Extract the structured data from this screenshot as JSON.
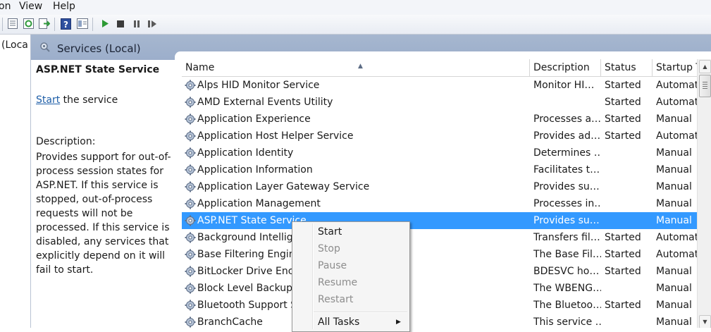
{
  "menubar": {
    "items": [
      "on",
      "View",
      "Help"
    ]
  },
  "tree": {
    "item_label": "(Loca"
  },
  "header": {
    "title": "Services (Local)"
  },
  "description_pane": {
    "title": "ASP.NET State Service",
    "start_link": "Start",
    "start_suffix": " the service",
    "description_label": "Description:",
    "description_text": "Provides support for out-of-process session states for ASP.NET. If this service is stopped, out-of-process requests will not be processed. If this service is disabled, any services that explicitly depend on it will fail to start."
  },
  "columns": [
    "Name",
    "Description",
    "Status",
    "Startup T"
  ],
  "services": [
    {
      "name": "Alps HID Monitor Service",
      "description": "Monitor HI…",
      "status": "Started",
      "startup": "Automat"
    },
    {
      "name": "AMD External Events Utility",
      "description": "",
      "status": "Started",
      "startup": "Automat"
    },
    {
      "name": "Application Experience",
      "description": "Processes a…",
      "status": "Started",
      "startup": "Manual"
    },
    {
      "name": "Application Host Helper Service",
      "description": "Provides ad…",
      "status": "Started",
      "startup": "Automat"
    },
    {
      "name": "Application Identity",
      "description": "Determines …",
      "status": "",
      "startup": "Manual"
    },
    {
      "name": "Application Information",
      "description": "Facilitates t…",
      "status": "",
      "startup": "Manual"
    },
    {
      "name": "Application Layer Gateway Service",
      "description": "Provides su…",
      "status": "",
      "startup": "Manual"
    },
    {
      "name": "Application Management",
      "description": "Processes in…",
      "status": "",
      "startup": "Manual"
    },
    {
      "name": "ASP.NET State Service",
      "description": "Provides su…",
      "status": "",
      "startup": "Manual"
    },
    {
      "name": "Background Intellige",
      "description": "Transfers fil…",
      "status": "Started",
      "startup": "Automat"
    },
    {
      "name": "Base Filtering Engine",
      "description": "The Base Fil…",
      "status": "Started",
      "startup": "Automat"
    },
    {
      "name": "BitLocker Drive Encry",
      "description": "BDESVC ho…",
      "status": "Started",
      "startup": "Manual"
    },
    {
      "name": "Block Level Backup E",
      "description": "The WBENG…",
      "status": "",
      "startup": "Manual"
    },
    {
      "name": "Bluetooth Support S",
      "description": "The Bluetoo…",
      "status": "Started",
      "startup": "Manual"
    },
    {
      "name": "BranchCache",
      "description": "This service …",
      "status": "",
      "startup": "Manual"
    }
  ],
  "selected_service": "ASP.NET State Service",
  "context_menu": {
    "start": "Start",
    "stop": "Stop",
    "pause": "Pause",
    "resume": "Resume",
    "restart": "Restart",
    "all_tasks": "All Tasks"
  },
  "colors": {
    "selection": "#3399ff",
    "header_band": "#a6b7cf",
    "link": "#1f5fa8"
  }
}
